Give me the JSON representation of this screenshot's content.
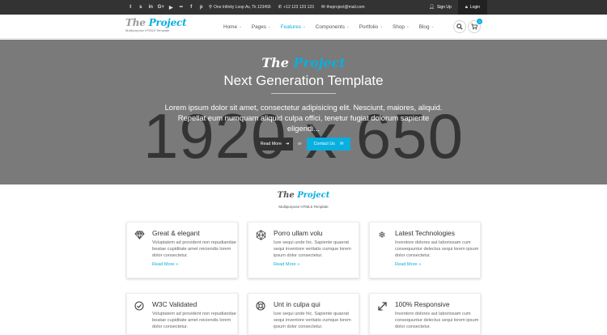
{
  "topbar": {
    "social": [
      {
        "icon": "twitter-icon",
        "glyph": "t"
      },
      {
        "icon": "skype-icon",
        "glyph": "s"
      },
      {
        "icon": "linkedin-icon",
        "glyph": "in"
      },
      {
        "icon": "google-plus-icon",
        "glyph": "G+"
      },
      {
        "icon": "youtube-icon",
        "glyph": "▶"
      },
      {
        "icon": "flickr-icon",
        "glyph": "••"
      },
      {
        "icon": "facebook-icon",
        "glyph": "f"
      },
      {
        "icon": "pinterest-icon",
        "glyph": "p"
      }
    ],
    "address": "One Infinity Loop Av, Tk 123456",
    "phone": "+12 123 123 123",
    "email": "theproject@mail.com",
    "signup": "Sign Up",
    "login": "Login"
  },
  "header": {
    "logo_part1": "The",
    "logo_part2": "Project",
    "tagline": "Multipurpose HTML5 Template",
    "nav": [
      {
        "label": "Home",
        "active": false
      },
      {
        "label": "Pages",
        "active": false
      },
      {
        "label": "Features",
        "active": true
      },
      {
        "label": "Components",
        "active": false
      },
      {
        "label": "Portfolio",
        "active": false
      },
      {
        "label": "Shop",
        "active": false
      },
      {
        "label": "Blog",
        "active": false
      }
    ],
    "cart_count": "0",
    "accent_color": "#09afdf"
  },
  "hero": {
    "placeholder_dims": "1920 x 650",
    "logo_part1": "The",
    "logo_part2": "Project",
    "title": "Next Generation Template",
    "text": "Lorem ipsum dolor sit amet, consectetur adipisicing elit. Nesciunt, maiores, aliquid. Repellat eum numquam aliquid culpa offici, tenetur fugiat dolorum sapiente eligendi...",
    "read_more": "Read More",
    "or": "or",
    "contact_us": "Contact Us"
  },
  "section": {
    "logo_part1": "The",
    "logo_part2": "Project",
    "tagline": "Multipurpose HTML5 Template"
  },
  "cards": [
    {
      "icon": "diamond-icon",
      "glyph": "◇",
      "title": "Great & elegant",
      "body": "Voluptatem ad provident non repudiandae beatae cupiditate amet reiciendis lorem dolor consectetur.",
      "more": "Read More »"
    },
    {
      "icon": "polyhedron-icon",
      "glyph": "⬡",
      "title": "Porro ullam volu",
      "body": "Iure sequi unde hic. Sapiente quaerat sequi inventore veritatis cumque lorem ipsum dolor consectetur.",
      "more": "Read More »"
    },
    {
      "icon": "snowflake-icon",
      "glyph": "❄",
      "title": "Latest Technologies",
      "body": "Inventore dolores aut laboriosam cum consequuntur delectus sequi lorem ipsum dolor consectetur.",
      "more": "Read More »"
    },
    {
      "icon": "check-circle-icon",
      "glyph": "✓",
      "title": "W3C Validated",
      "body": "Voluptatem ad provident non repudiandae beatae cupiditate amet reiciendis lorem dolor consectetur."
    },
    {
      "icon": "lifebuoy-icon",
      "glyph": "◎",
      "title": "Unt in culpa qui",
      "body": "Iure sequi unde hic. Sapiente quaerat sequi inventore veritatis cumque lorem ipsum dolor consectetur."
    },
    {
      "icon": "expand-arrows-icon",
      "glyph": "⤢",
      "title": "100% Responsive",
      "body": "Inventore dolores aut laboriosam cum consequuntur delectus sequi lorem ipsum dolor consectetur."
    }
  ]
}
